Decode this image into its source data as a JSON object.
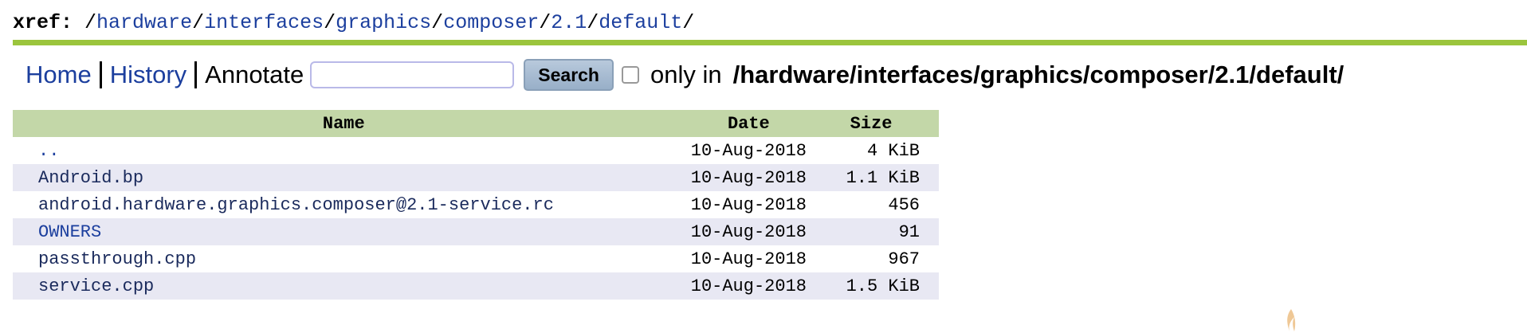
{
  "breadcrumb": {
    "label": "xref:",
    "slash0": "/",
    "segments": [
      "hardware",
      "interfaces",
      "graphics",
      "composer",
      "2.1",
      "default"
    ],
    "trailing": "/"
  },
  "nav": {
    "home": "Home",
    "history": "History",
    "annotate": "Annotate",
    "search_value": "",
    "search_button": "Search",
    "only_in": "only in",
    "path": "/hardware/interfaces/graphics/composer/2.1/default/"
  },
  "table": {
    "headers": {
      "name": "Name",
      "date": "Date",
      "size": "Size"
    },
    "rows": [
      {
        "name": "..",
        "date": "10-Aug-2018",
        "size": "4 KiB"
      },
      {
        "name": "Android.bp",
        "date": "10-Aug-2018",
        "size": "1.1 KiB"
      },
      {
        "name": "android.hardware.graphics.composer@2.1-service.rc",
        "date": "10-Aug-2018",
        "size": "456"
      },
      {
        "name": "OWNERS",
        "date": "10-Aug-2018",
        "size": "91"
      },
      {
        "name": "passthrough.cpp",
        "date": "10-Aug-2018",
        "size": "967"
      },
      {
        "name": "service.cpp",
        "date": "10-Aug-2018",
        "size": "1.5 KiB"
      }
    ]
  },
  "colors": {
    "link": "#1c3f9e",
    "accent_bar": "#9bc53d",
    "table_header": "#c3d7a8",
    "row_alt": "#e8e8f3"
  }
}
